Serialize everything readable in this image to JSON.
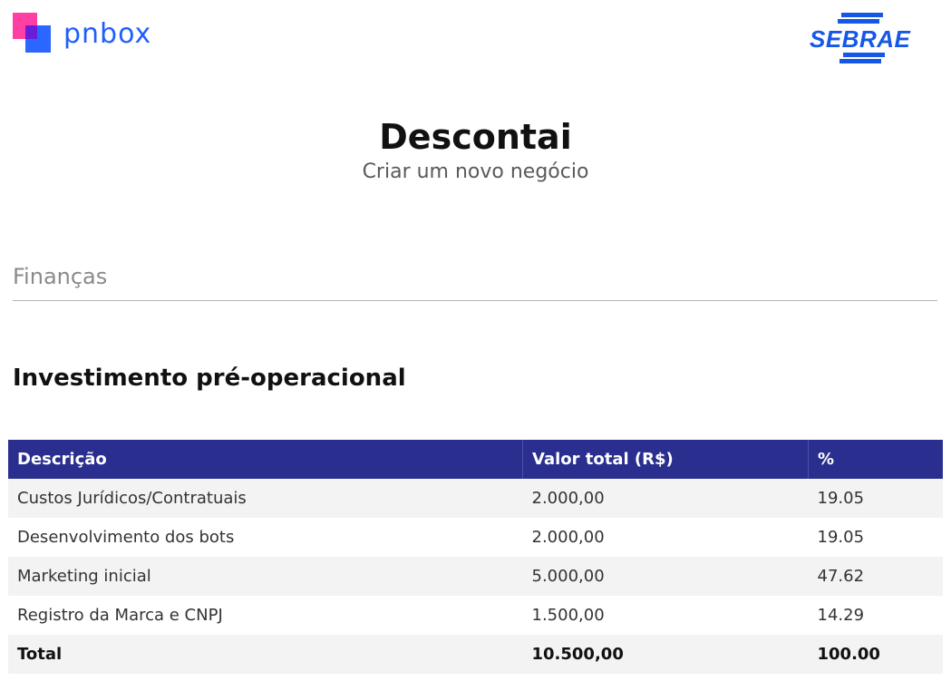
{
  "header": {
    "brand_left": "pnbox",
    "brand_right": "SEBRAE",
    "colors": {
      "pnbox_blue": "#1f5fff",
      "pnbox_pink": "#ff3fa4",
      "sebrae_blue": "#1557e6"
    }
  },
  "page": {
    "title": "Descontai",
    "subtitle": "Criar um novo negócio"
  },
  "section": {
    "title": "Finanças"
  },
  "subsection": {
    "title": "Investimento pré-operacional"
  },
  "table": {
    "header_color": "#2a2f8f",
    "columns": [
      "Descrição",
      "Valor total (R$)",
      "%"
    ],
    "rows": [
      {
        "description": "Custos Jurídicos/Contratuais",
        "value": "2.000,00",
        "percent": "19.05"
      },
      {
        "description": "Desenvolvimento dos bots",
        "value": "2.000,00",
        "percent": "19.05"
      },
      {
        "description": "Marketing inicial",
        "value": "5.000,00",
        "percent": "47.62"
      },
      {
        "description": "Registro da Marca e CNPJ",
        "value": "1.500,00",
        "percent": "14.29"
      }
    ],
    "total": {
      "label": "Total",
      "value": "10.500,00",
      "percent": "100.00"
    }
  }
}
